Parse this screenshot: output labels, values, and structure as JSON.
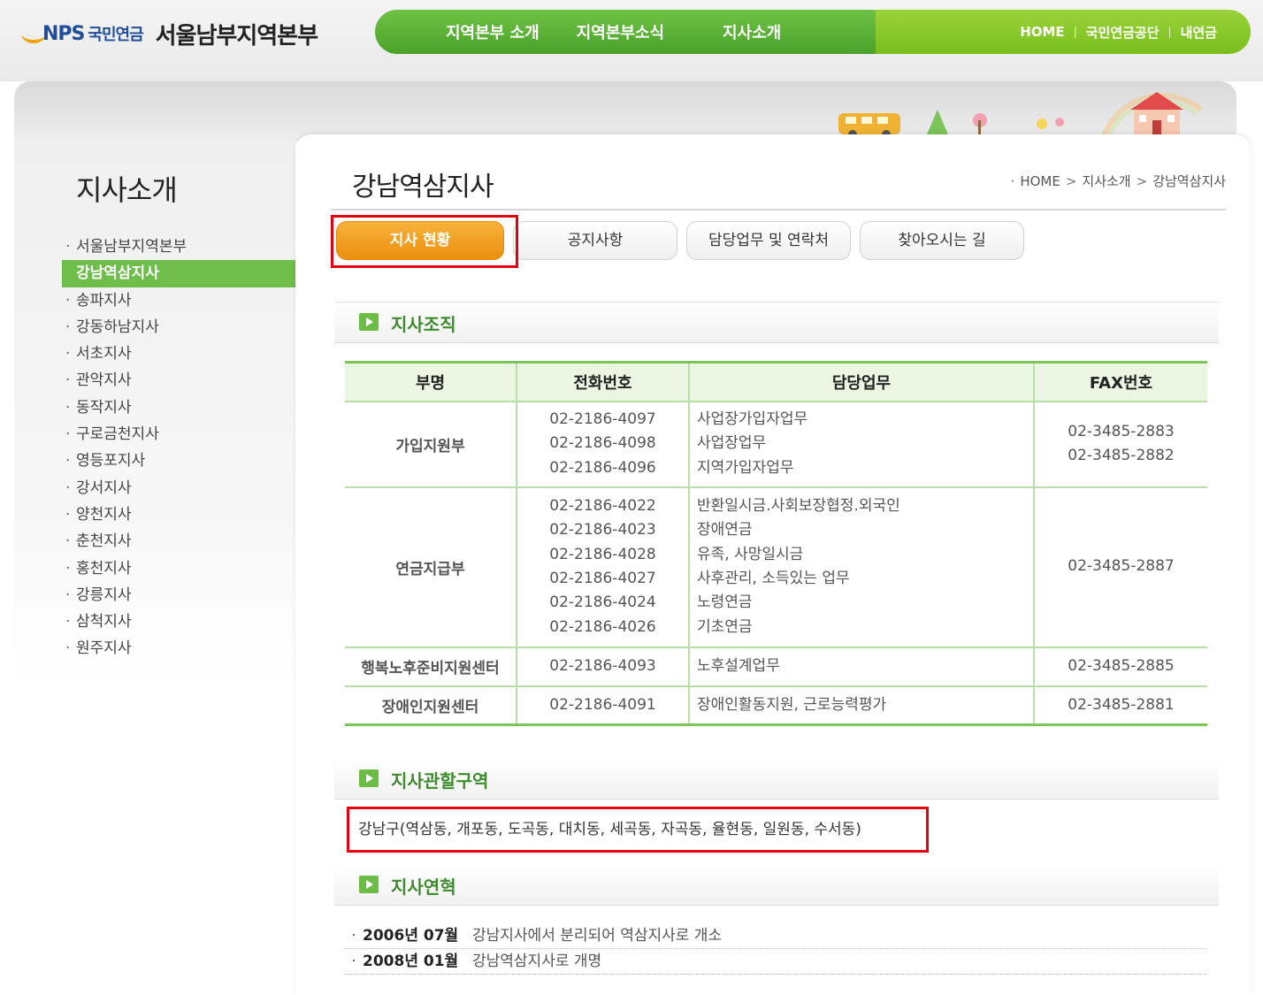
{
  "header": {
    "logo_nps": "NPS",
    "logo_korean": "국민연금",
    "region_title": "서울남부지역본부",
    "gnb": [
      "지역본부 소개",
      "지역본부소식",
      "지사소개"
    ],
    "util": [
      "HOME",
      "국민연금공단",
      "내연금"
    ]
  },
  "lnb": {
    "title": "지사소개",
    "items": [
      {
        "label": "서울남부지역본부",
        "active": false
      },
      {
        "label": "강남역삼지사",
        "active": true
      },
      {
        "label": "송파지사",
        "active": false
      },
      {
        "label": "강동하남지사",
        "active": false
      },
      {
        "label": "서초지사",
        "active": false
      },
      {
        "label": "관악지사",
        "active": false
      },
      {
        "label": "동작지사",
        "active": false
      },
      {
        "label": "구로금천지사",
        "active": false
      },
      {
        "label": "영등포지사",
        "active": false
      },
      {
        "label": "강서지사",
        "active": false
      },
      {
        "label": "양천지사",
        "active": false
      },
      {
        "label": "춘천지사",
        "active": false
      },
      {
        "label": "홍천지사",
        "active": false
      },
      {
        "label": "강릉지사",
        "active": false
      },
      {
        "label": "삼척지사",
        "active": false
      },
      {
        "label": "원주지사",
        "active": false
      }
    ]
  },
  "content": {
    "page_title": "강남역삼지사",
    "breadcrumb": [
      "HOME",
      "지사소개",
      "강남역삼지사"
    ],
    "tabs": [
      {
        "label": "지사 현황",
        "active": true
      },
      {
        "label": "공지사항",
        "active": false
      },
      {
        "label": "담당업무 및 연락처",
        "active": false
      },
      {
        "label": "찾아오시는 길",
        "active": false
      }
    ],
    "section_org": "지사조직",
    "section_area": "지사관할구역",
    "section_history": "지사연혁",
    "table": {
      "headers": [
        "부명",
        "전화번호",
        "담당업무",
        "FAX번호"
      ],
      "rows": [
        {
          "dept": "가입지원부",
          "phones": [
            "02-2186-4097",
            "02-2186-4098",
            "02-2186-4096"
          ],
          "duties": [
            "사업장가입자업무",
            "사업장업무",
            "지역가입자업무"
          ],
          "faxes": [
            "02-3485-2883",
            "02-3485-2882"
          ]
        },
        {
          "dept": "연금지급부",
          "phones": [
            "02-2186-4022",
            "02-2186-4023",
            "02-2186-4028",
            "02-2186-4027",
            "02-2186-4024",
            "02-2186-4026"
          ],
          "duties": [
            "반환일시금.사회보장협정.외국인",
            "장애연금",
            "유족, 사망일시금",
            "사후관리, 소득있는 업무",
            "노령연금",
            "기초연금"
          ],
          "faxes": [
            "02-3485-2887"
          ]
        },
        {
          "dept": "행복노후준비지원센터",
          "phones": [
            "02-2186-4093"
          ],
          "duties": [
            "노후설계업무"
          ],
          "faxes": [
            "02-3485-2885"
          ]
        },
        {
          "dept": "장애인지원센터",
          "phones": [
            "02-2186-4091"
          ],
          "duties": [
            "장애인활동지원, 근로능력평가"
          ],
          "faxes": [
            "02-3485-2881"
          ]
        }
      ]
    },
    "area_text": "강남구(역삼동, 개포동, 도곡동, 대치동, 세곡동, 자곡동, 율현동, 일원동, 수서동)",
    "history": [
      {
        "date": "2006년 07월",
        "desc": "강남지사에서 분리되어 역삼지사로 개소"
      },
      {
        "date": "2008년 01월",
        "desc": "강남역삼지사로 개명"
      }
    ]
  }
}
